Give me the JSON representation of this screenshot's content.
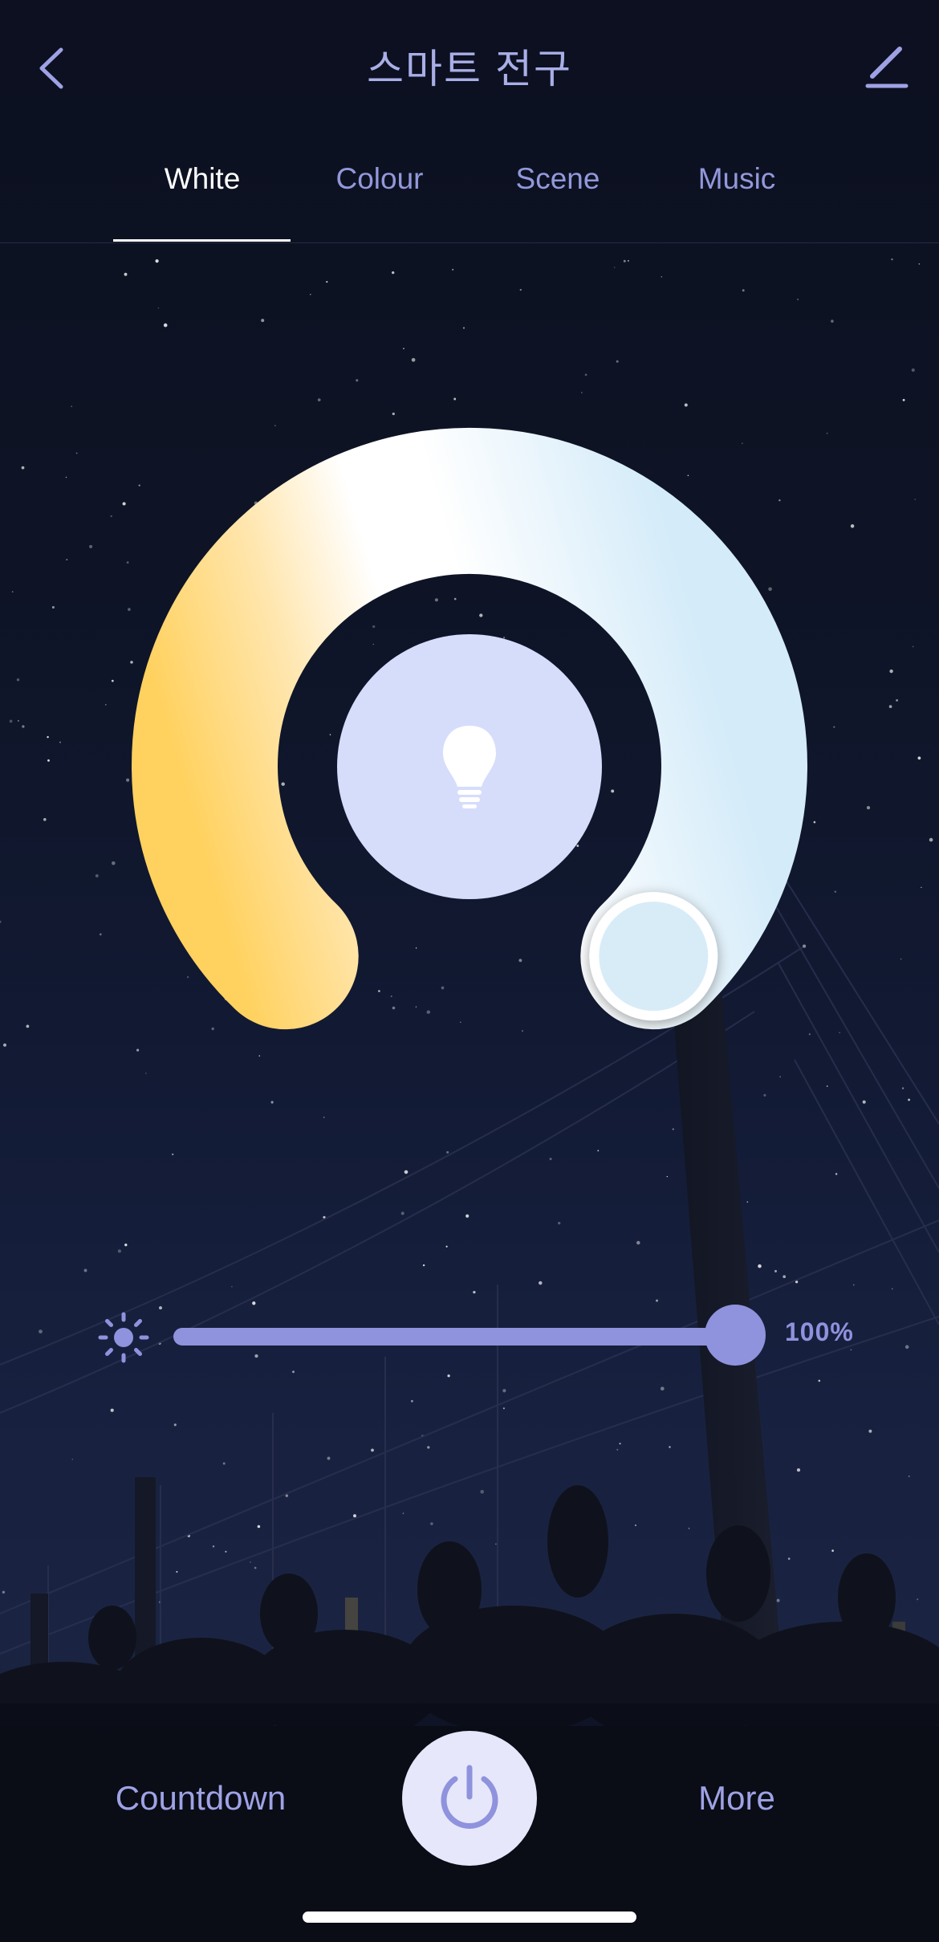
{
  "header": {
    "title": "스마트 전구",
    "back_icon": "chevron-left-icon",
    "edit_icon": "pencil-icon"
  },
  "tabs": [
    {
      "label": "White",
      "active": true
    },
    {
      "label": "Colour",
      "active": false
    },
    {
      "label": "Scene",
      "active": false
    },
    {
      "label": "Music",
      "active": false
    }
  ],
  "color_temperature": {
    "ring_warm_color": "#ffd26a",
    "ring_cool_color": "#d6ecf9",
    "center_color": "#d6ddfb",
    "center_icon": "light-bulb-icon",
    "value": 1.0
  },
  "brightness": {
    "icon": "sun-icon",
    "value": 100,
    "value_label": "100%",
    "accent": "#8f92dd"
  },
  "bottom_bar": {
    "countdown_label": "Countdown",
    "more_label": "More",
    "power_icon": "power-icon"
  },
  "colors": {
    "accent": "#9ea2e4",
    "tab_active": "#ffffff",
    "tab_inactive": "#9298da",
    "power_button_bg": "#e6e7fa"
  }
}
